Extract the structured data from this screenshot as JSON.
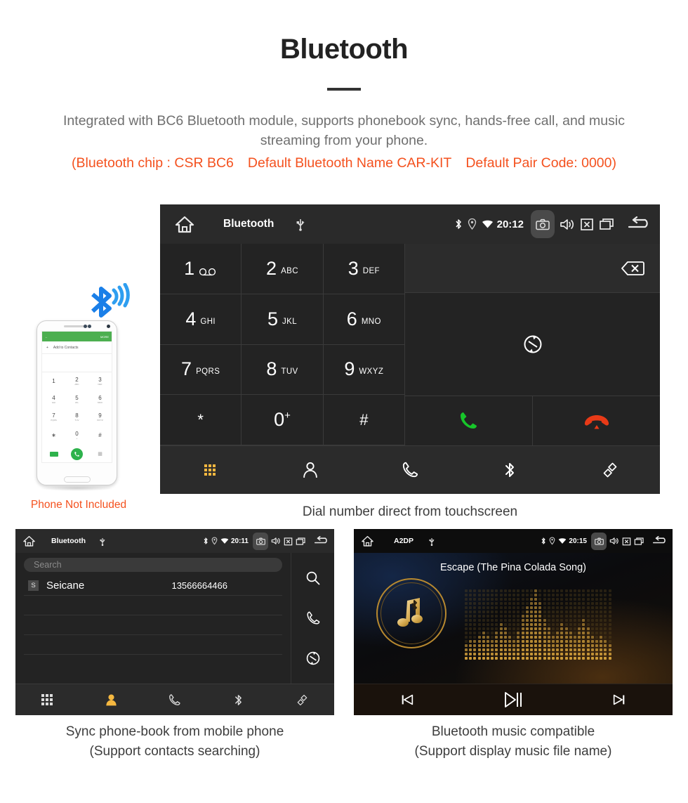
{
  "header": {
    "title": "Bluetooth",
    "subtitle": "Integrated with BC6 Bluetooth module, supports phonebook sync, hands-free call, and music streaming from your phone.",
    "spec_chip": "(Bluetooth chip : CSR BC6",
    "spec_name": "Default Bluetooth Name CAR-KIT",
    "spec_pair": "Default Pair Code: 0000)",
    "accent_color": "#f4511e",
    "subtitle_color": "#6f6f6f"
  },
  "main_unit": {
    "statusbar": {
      "home_icon": "home-icon",
      "title": "Bluetooth",
      "usb_icon": "usb-icon",
      "bluetooth_icon": "bluetooth-icon",
      "location_icon": "location-icon",
      "wifi_icon": "wifi-icon",
      "time": "20:12",
      "camera_icon": "camera-icon",
      "volume_icon": "volume-icon",
      "close_icon": "close-box-icon",
      "recents_icon": "recents-icon",
      "back_icon": "back-icon"
    },
    "keys": [
      {
        "digit": "1",
        "letters": "",
        "voicemail": true
      },
      {
        "digit": "2",
        "letters": "ABC"
      },
      {
        "digit": "3",
        "letters": "DEF"
      },
      {
        "digit": "4",
        "letters": "GHI"
      },
      {
        "digit": "5",
        "letters": "JKL"
      },
      {
        "digit": "6",
        "letters": "MNO"
      },
      {
        "digit": "7",
        "letters": "PQRS"
      },
      {
        "digit": "8",
        "letters": "TUV"
      },
      {
        "digit": "9",
        "letters": "WXYZ"
      },
      {
        "digit": "*",
        "letters": ""
      },
      {
        "digit": "0",
        "letters": "",
        "sup": "+"
      },
      {
        "digit": "#",
        "letters": ""
      }
    ],
    "backspace_icon": "backspace-icon",
    "sync_icon": "sync-icon",
    "call_icon": "call-icon",
    "hangup_icon": "hangup-icon",
    "call_color": "#17c52a",
    "hangup_color": "#e83a17",
    "navbar": [
      {
        "name": "keypad",
        "icon": "keypad-icon",
        "active": true
      },
      {
        "name": "contacts",
        "icon": "person-icon",
        "active": false
      },
      {
        "name": "call-log",
        "icon": "phone-icon",
        "active": false
      },
      {
        "name": "bluetooth",
        "icon": "bluetooth-icon",
        "active": false
      },
      {
        "name": "link",
        "icon": "link-icon",
        "active": false
      }
    ],
    "active_color": "#f5b840",
    "caption": "Dial number direct from touchscreen"
  },
  "phone_mock": {
    "appbar_back": "back-arrow-icon",
    "appbar_more": "MORE",
    "add_contacts": "Add to Contacts",
    "keys": [
      {
        "d": "1",
        "s": ""
      },
      {
        "d": "2",
        "s": "ABC"
      },
      {
        "d": "3",
        "s": "DEF"
      },
      {
        "d": "4",
        "s": "GHI"
      },
      {
        "d": "5",
        "s": "JKL"
      },
      {
        "d": "6",
        "s": "MNO"
      },
      {
        "d": "7",
        "s": "PQRS"
      },
      {
        "d": "8",
        "s": "TUV"
      },
      {
        "d": "9",
        "s": "WXYZ"
      },
      {
        "d": "∗",
        "s": ""
      },
      {
        "d": "0",
        "s": "+"
      },
      {
        "d": "#",
        "s": ""
      }
    ],
    "not_included": "Phone Not Included",
    "bluetooth_wave_icon": "bluetooth-wave-icon",
    "bluetooth_color": "#1a7fe8"
  },
  "phonebook_unit": {
    "statusbar": {
      "home_icon": "home-icon",
      "title": "Bluetooth",
      "usb_icon": "usb-icon",
      "time": "20:11"
    },
    "search_placeholder": "Search",
    "contacts": [
      {
        "initial": "S",
        "name": "Seicane",
        "number": "13566664466"
      }
    ],
    "side_icons": [
      {
        "name": "search",
        "icon": "search-icon"
      },
      {
        "name": "call",
        "icon": "phone-icon"
      },
      {
        "name": "sync",
        "icon": "sync-icon"
      }
    ],
    "navbar": [
      {
        "name": "keypad",
        "icon": "keypad-icon",
        "active": false
      },
      {
        "name": "contacts",
        "icon": "person-icon",
        "active": true
      },
      {
        "name": "call-log",
        "icon": "phone-icon",
        "active": false
      },
      {
        "name": "bluetooth",
        "icon": "bluetooth-icon",
        "active": false
      },
      {
        "name": "link",
        "icon": "link-icon",
        "active": false
      }
    ],
    "caption_line1": "Sync phone-book from mobile phone",
    "caption_line2": "(Support contacts searching)"
  },
  "music_unit": {
    "statusbar": {
      "home_icon": "home-icon",
      "title": "A2DP",
      "usb_icon": "usb-icon",
      "time": "20:15"
    },
    "song_title": "Escape (The Pina Colada Song)",
    "album_icon": "music-note-bluetooth-icon",
    "visualizer_icon": "spectrum-visualizer",
    "controls": [
      {
        "name": "previous",
        "icon": "skip-previous-icon"
      },
      {
        "name": "play-pause",
        "icon": "play-pause-icon"
      },
      {
        "name": "next",
        "icon": "skip-next-icon"
      }
    ],
    "gold_color": "#d4a13c",
    "caption_line1": "Bluetooth music compatible",
    "caption_line2": "(Support display music file name)"
  }
}
